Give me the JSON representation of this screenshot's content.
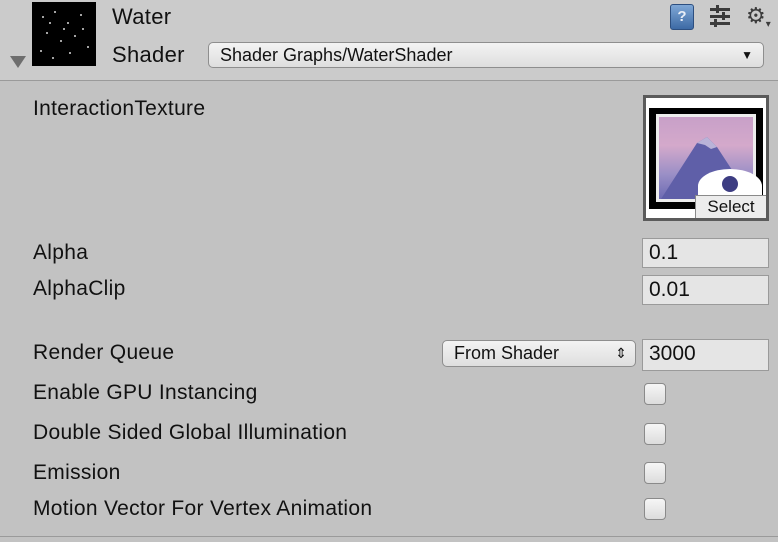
{
  "header": {
    "title": "Water",
    "shader_label": "Shader",
    "shader_value": "Shader Graphs/WaterShader",
    "icons": [
      "help-icon",
      "preset-icon",
      "gear-icon"
    ]
  },
  "properties": {
    "interaction_texture_label": "InteractionTexture",
    "select_label": "Select",
    "alpha_label": "Alpha",
    "alpha_value": "0.1",
    "alphaclip_label": "AlphaClip",
    "alphaclip_value": "0.01",
    "render_queue_label": "Render Queue",
    "render_queue_mode": "From Shader",
    "render_queue_value": "3000",
    "gpu_instancing_label": "Enable GPU Instancing",
    "gpu_instancing_checked": false,
    "double_sided_gi_label": "Double Sided Global Illumination",
    "double_sided_gi_checked": false,
    "emission_label": "Emission",
    "emission_checked": false,
    "motion_vector_label": "Motion Vector For Vertex Animation",
    "motion_vector_checked": false
  }
}
